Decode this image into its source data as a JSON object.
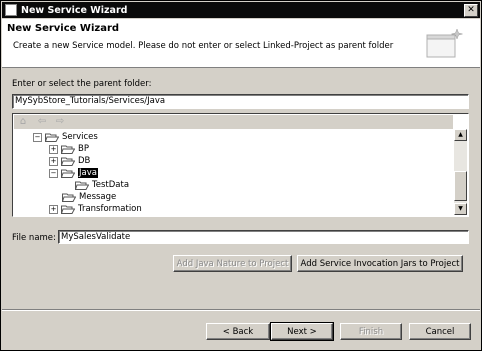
{
  "window": {
    "title": "New Service Wizard"
  },
  "header": {
    "title": "New Service Wizard",
    "description": "Create a new Service model.  Please do not enter or select Linked-Project as parent folder"
  },
  "parent_folder": {
    "label": "Enter or select the parent folder:",
    "value": "MySybStore_Tutorials/Services/Java"
  },
  "tree": {
    "items": [
      {
        "label": "Services",
        "expander": "-"
      },
      {
        "label": "BP",
        "expander": "+"
      },
      {
        "label": "DB",
        "expander": "+"
      },
      {
        "label": "Java",
        "expander": "-",
        "selected": true
      },
      {
        "label": "TestData",
        "expander": ""
      },
      {
        "label": "Message",
        "expander": ""
      },
      {
        "label": "Transformation",
        "expander": "+"
      }
    ]
  },
  "file_name": {
    "label": "File name:",
    "value": "MySalesValidate"
  },
  "actions": {
    "add_java_nature": "Add Java Nature to Project",
    "add_service_jars": "Add Service Invocation Jars to Project"
  },
  "footer": {
    "back": "< Back",
    "next": "Next >",
    "finish": "Finish",
    "cancel": "Cancel"
  }
}
